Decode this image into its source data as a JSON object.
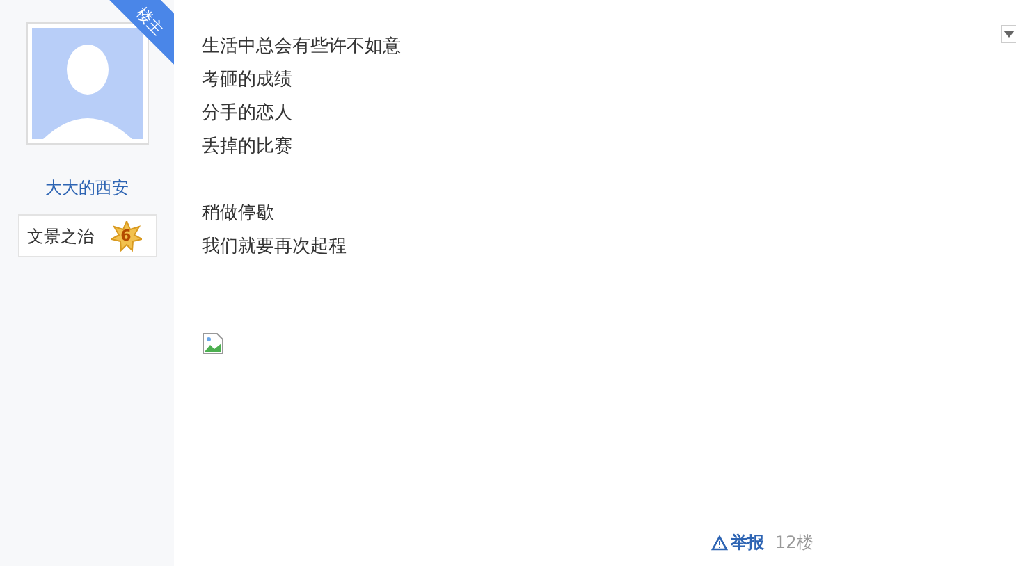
{
  "author": {
    "corner_tag": "楼主",
    "name": "大大的西安",
    "title_badge": {
      "label": "文景之治",
      "level": "6"
    }
  },
  "post": {
    "paragraphs": [
      [
        "生活中总会有些许不如意",
        "考砸的成绩",
        "分手的恋人",
        "丢掉的比赛"
      ],
      [
        "稍做停歇",
        "我们就要再次起程"
      ]
    ],
    "image": {
      "broken": true
    }
  },
  "footer": {
    "report": "举报",
    "floor": "12楼"
  }
}
